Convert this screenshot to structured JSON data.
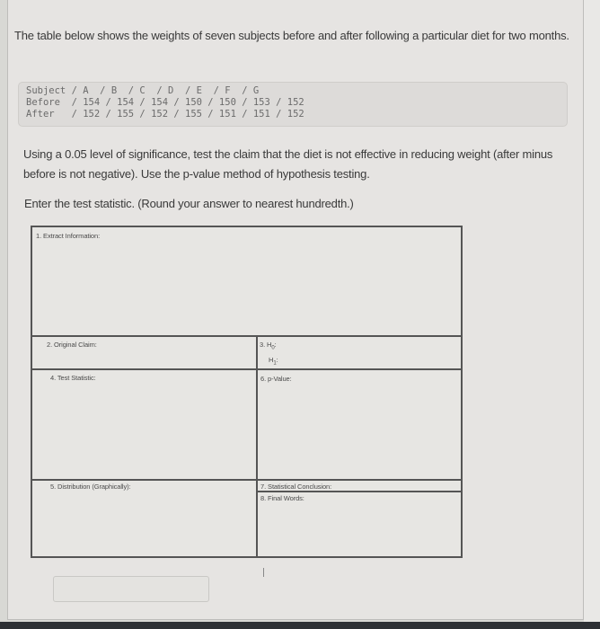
{
  "intro": {
    "text": "The table below shows the weights of seven subjects before and after following a particular diet for two months."
  },
  "data_table": {
    "rows": [
      "Subject / A  / B  / C  / D  / E  / F  / G",
      "Before  / 154 / 154 / 154 / 150 / 150 / 153 / 152",
      "After   / 152 / 155 / 152 / 155 / 151 / 151 / 152"
    ],
    "subjects": [
      "A",
      "B",
      "C",
      "D",
      "E",
      "F",
      "G"
    ],
    "before": [
      154,
      154,
      154,
      150,
      150,
      153,
      152
    ],
    "after": [
      152,
      155,
      152,
      155,
      151,
      151,
      152
    ]
  },
  "question": {
    "text": "Using a 0.05 level of significance, test the claim that the diet is not effective in reducing weight (after minus before is not negative). Use the p-value method of hypothesis testing.",
    "instruction": "Enter the test statistic. (Round your answer to nearest hundredth.)"
  },
  "form": {
    "extract_information": "1. Extract Information:",
    "original_claim": "2. Original Claim:",
    "h0_label": "3. H",
    "h0_sub": "0",
    "h1_label": "H",
    "h1_sub": "1",
    "test_statistic": "4. Test Statistic:",
    "p_value": "6. p-Value:",
    "distribution": "5. Distribution (Graphically):",
    "statistical_conclusion": "7. Statistical Conclusion:",
    "final_words": "8. Final Words:"
  },
  "answer": {
    "value": "",
    "placeholder": ""
  }
}
